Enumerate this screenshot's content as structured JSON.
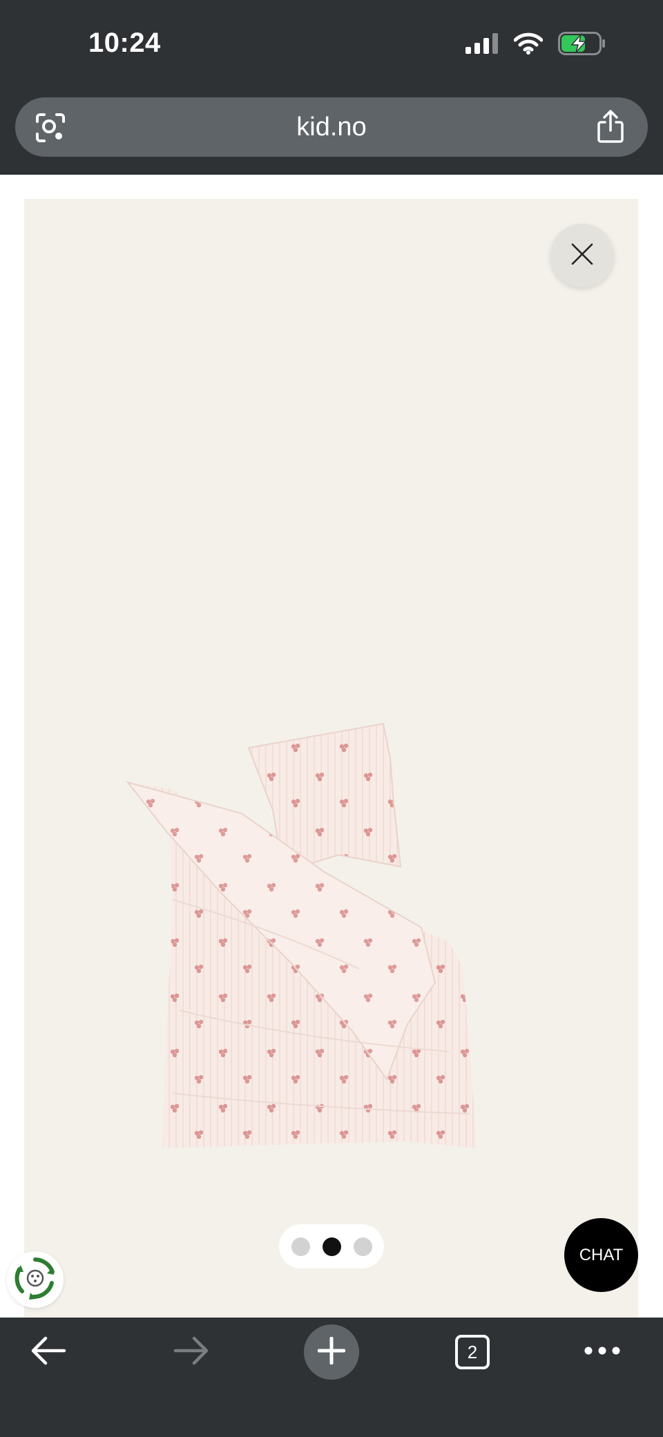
{
  "status_bar": {
    "time": "10:24",
    "icons": [
      "cellular-signal-icon",
      "wifi-icon",
      "battery-charging-icon"
    ]
  },
  "browser": {
    "url": "kid.no",
    "left_icon": "page-scan-icon",
    "right_icon": "share-icon"
  },
  "gallery": {
    "close_icon": "close-icon",
    "image_subject": "bedding-set-image",
    "dots_total": 3,
    "active_dot": 1
  },
  "chat": {
    "label": "CHAT"
  },
  "eco_badge": {
    "icon": "recycle-badge-icon"
  },
  "toolbar": {
    "tab_count": "2",
    "icons": [
      "back-arrow-icon",
      "forward-arrow-icon",
      "new-tab-plus-icon",
      "tabs-icon",
      "more-icon"
    ]
  },
  "colors": {
    "chrome_bg": "#2f3235",
    "urlbar_bg": "#5f6468",
    "gallery_bg": "#f3f1ea",
    "fabric": "#f7e8e3",
    "print": "#d98e8b"
  }
}
